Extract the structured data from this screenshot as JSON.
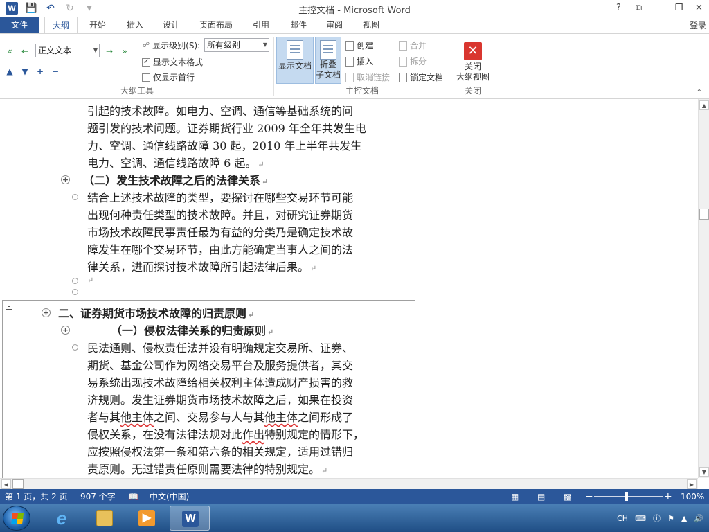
{
  "window": {
    "title": "主控文档 - Microsoft Word",
    "app_icon": "W",
    "controls": [
      "?",
      "⧉",
      "—",
      "❐",
      "✕"
    ]
  },
  "qat": {
    "icons": [
      "save-icon",
      "undo-icon",
      "redo-icon",
      "customize-icon"
    ]
  },
  "ribbon": {
    "tabs": [
      "文件",
      "大纲",
      "开始",
      "插入",
      "设计",
      "页面布局",
      "引用",
      "邮件",
      "审阅",
      "视图"
    ],
    "active_tab": "大纲",
    "login": "登录",
    "outline_tools": {
      "level_select": "正文文本",
      "show_level_label": "显示级别(S):",
      "show_level_value": "所有级别",
      "show_text_format": "显示文本格式",
      "show_text_format_checked": true,
      "show_first_line": "仅显示首行",
      "show_first_line_checked": false,
      "group_label": "大纲工具"
    },
    "master_doc": {
      "show_doc": "显示文档",
      "collapse_line1": "折叠",
      "collapse_line2": "子文档",
      "create": "创建",
      "insert": "插入",
      "unlink": "取消链接",
      "merge": "合并",
      "split": "拆分",
      "lock": "锁定文档",
      "group_label": "主控文档"
    },
    "close": {
      "line1": "关闭",
      "line2": "大纲视图",
      "group_label": "关闭"
    }
  },
  "document": {
    "lines": [
      "引起的技术故障。如电力、空调、通信等基础系统的问",
      "题引发的技术问题。证券期货行业 2009 年全年共发生电",
      "力、空调、通信线路故障 30 起，2010 年上半年共发生",
      "电力、空调、通信线路故障 6 起。",
      "（二）发生技术故障之后的法律关系",
      "结合上述技术故障的类型，要探讨在哪些交易环节可能",
      "出现何种责任类型的技术故障。并且，对研究证券期货",
      "市场技术故障民事责任最为有益的分类乃是确定技术故",
      "障发生在哪个交易环节，由此方能确定当事人之间的法",
      "律关系，进而探讨技术故障所引起法律后果。",
      "二、证券期货市场技术故障的归责原则",
      "（一）侵权法律关系的归责原则",
      "民法通则、侵权责任法并没有明确规定交易所、证券、",
      "期货、基金公司作为网络交易平台及服务提供者，其交",
      "易系统出现技术故障给相关权利主体造成财产损害的救",
      "济规则。发生证券期货市场技术故障之后，如果在投资",
      "者与其",
      "他主体",
      "之间、交易参与人与其",
      "他主体",
      "之间形成了",
      "侵权关系，在没有法律法规对此",
      "作出",
      "特别规定的情形下，",
      "应按照侵权法第一条和第六条的相关规定，适用过错归",
      "责原则。无过错责任原则需要法律的特别规定。"
    ]
  },
  "status": {
    "page": "第 1 页，共 2 页",
    "words": "907 个字",
    "language": "中文(中国)",
    "zoom": "100%",
    "zoom_minus": "−",
    "zoom_plus": "+"
  },
  "taskbar": {
    "apps": [
      "start-button",
      "internet-explorer",
      "file-explorer",
      "media-player",
      "word"
    ],
    "tray_lang": "CH"
  }
}
